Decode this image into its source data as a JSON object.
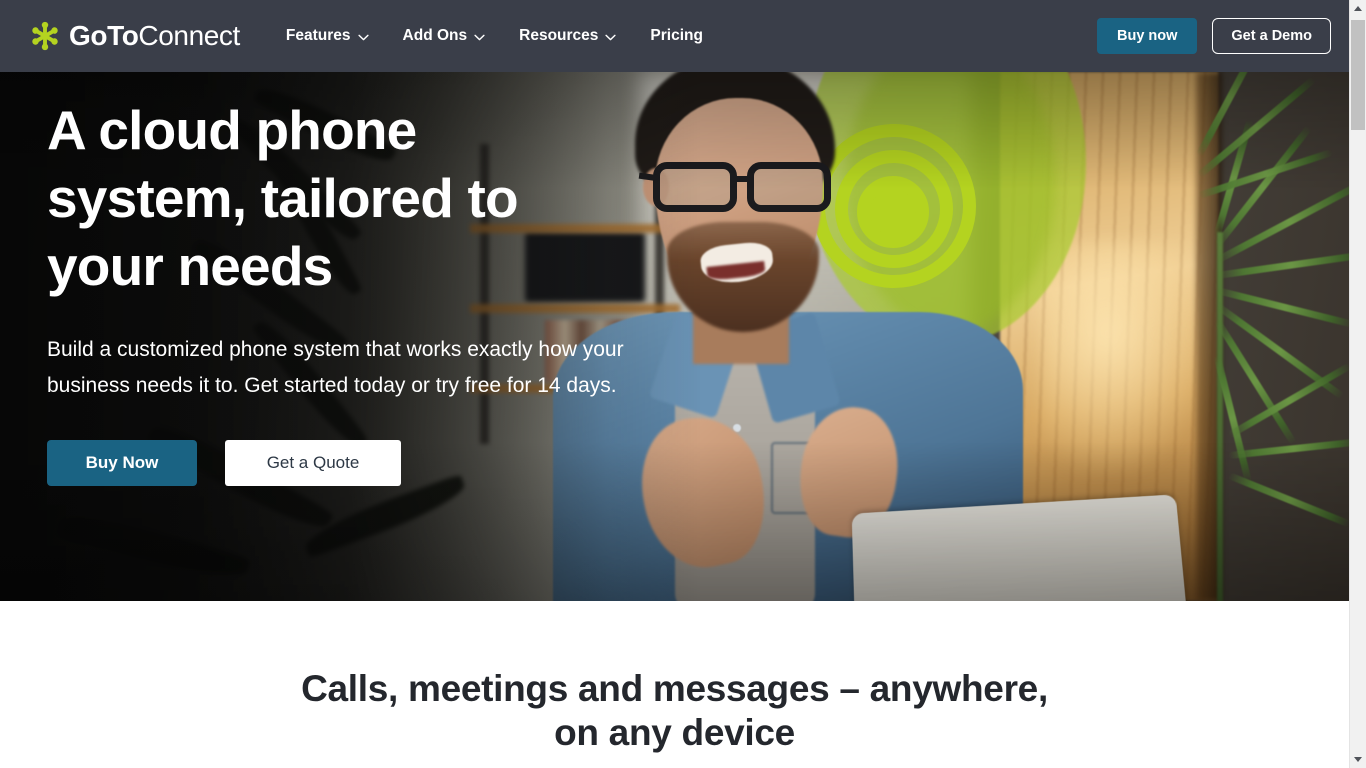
{
  "header": {
    "brand": {
      "strong": "GoTo",
      "light": "Connect",
      "logo_icon": "goto-asterisk-logo"
    },
    "nav": [
      {
        "label": "Features",
        "has_dropdown": true
      },
      {
        "label": "Add Ons",
        "has_dropdown": true
      },
      {
        "label": "Resources",
        "has_dropdown": true
      },
      {
        "label": "Pricing",
        "has_dropdown": false
      }
    ],
    "buy_now_label": "Buy now",
    "demo_label": "Get a Demo",
    "background_color": "#3a3e49",
    "accent_color": "#1a6383"
  },
  "hero": {
    "title": "A cloud phone system, tailored to your needs",
    "subtitle": "Build a customized phone system that works exactly how your business needs it to. Get started today or try free for 14 days.",
    "primary_button": "Buy Now",
    "secondary_button": "Get a Quote",
    "image_alt": "Smiling man with glasses in denim shirt talking on a video call on a laptop",
    "brand_green": "#b4d320"
  },
  "section": {
    "title": "Calls, meetings and messages – anywhere, on any device",
    "text_color": "#24272d"
  },
  "scrollbar": {
    "up_arrow": "scroll-up-arrow",
    "down_arrow": "scroll-down-arrow",
    "thumb": "scroll-thumb"
  }
}
